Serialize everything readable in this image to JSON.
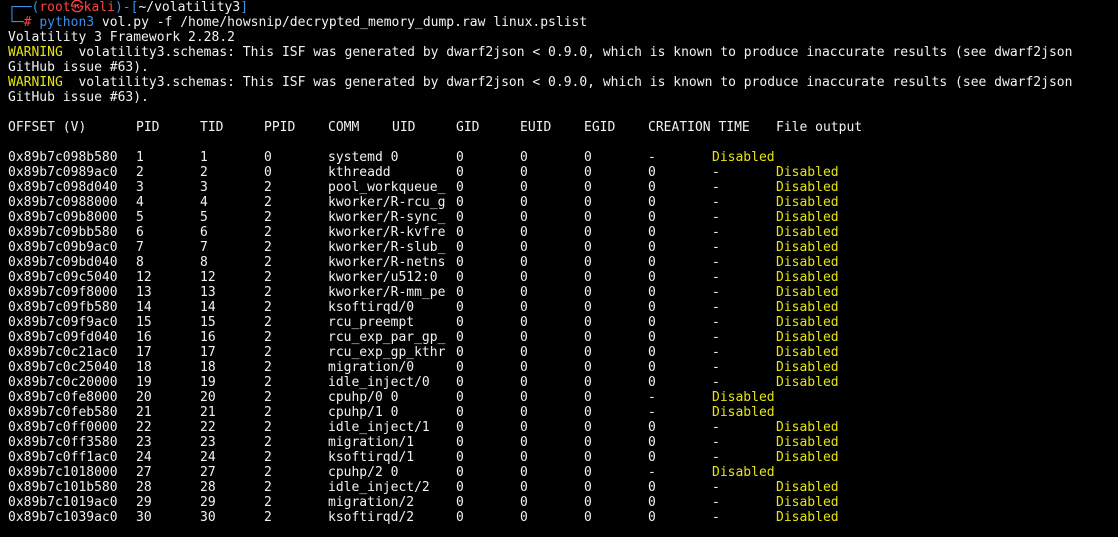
{
  "prompt": {
    "corner_top": "┌──(",
    "user": "root",
    "skull": "㉿",
    "host": "kali",
    "mid": ")-[",
    "path": "~/volatility3",
    "end": "]",
    "corner_bottom": "└─",
    "hash": "#",
    "command": "python3",
    "args": " vol.py -f /home/howsnip/decrypted_memory_dump.raw linux.pslist"
  },
  "output": {
    "framework": "Volatility 3 Framework 2.28.2",
    "warning_label": "WARNING",
    "warning_text": "  volatility3.schemas: This ISF was generated by dwarf2json < 0.9.0, which is known to produce inaccurate results (see dwarf2json",
    "warning_cont": "GitHub issue #63)."
  },
  "table": {
    "headers": {
      "offset": "OFFSET (V)",
      "pid": "PID",
      "tid": "TID",
      "ppid": "PPID",
      "comm": "COMM",
      "uid": "UID",
      "gid": "GID",
      "euid": "EUID",
      "egid": "EGID",
      "ctime": "CREATION TIME",
      "fout": "File output"
    },
    "rows": [
      {
        "offset": "0x89b7c098b580",
        "pid": "1",
        "tid": "1",
        "ppid": "0",
        "comm": "systemd 0",
        "gid": "0",
        "euid": "0",
        "egid": "0",
        "ctime": "-",
        "fout": "Disabled",
        "shift": true
      },
      {
        "offset": "0x89b7c0989ac0",
        "pid": "2",
        "tid": "2",
        "ppid": "0",
        "comm": "kthreadd",
        "gid": "0",
        "euid": "0",
        "egid": "0",
        "extra": "0",
        "ctime": "-",
        "fout": "Disabled"
      },
      {
        "offset": "0x89b7c098d040",
        "pid": "3",
        "tid": "3",
        "ppid": "2",
        "comm": "pool_workqueue_",
        "gid": "0",
        "euid": "0",
        "egid": "0",
        "extra": "0",
        "ctime": "-",
        "fout": "Disabled"
      },
      {
        "offset": "0x89b7c0988000",
        "pid": "4",
        "tid": "4",
        "ppid": "2",
        "comm": "kworker/R-rcu_g",
        "gid": "0",
        "euid": "0",
        "egid": "0",
        "extra": "0",
        "ctime": "-",
        "fout": "Disabled"
      },
      {
        "offset": "0x89b7c09b8000",
        "pid": "5",
        "tid": "5",
        "ppid": "2",
        "comm": "kworker/R-sync_",
        "gid": "0",
        "euid": "0",
        "egid": "0",
        "extra": "0",
        "ctime": "-",
        "fout": "Disabled"
      },
      {
        "offset": "0x89b7c09bb580",
        "pid": "6",
        "tid": "6",
        "ppid": "2",
        "comm": "kworker/R-kvfre",
        "gid": "0",
        "euid": "0",
        "egid": "0",
        "extra": "0",
        "ctime": "-",
        "fout": "Disabled"
      },
      {
        "offset": "0x89b7c09b9ac0",
        "pid": "7",
        "tid": "7",
        "ppid": "2",
        "comm": "kworker/R-slub_",
        "gid": "0",
        "euid": "0",
        "egid": "0",
        "extra": "0",
        "ctime": "-",
        "fout": "Disabled"
      },
      {
        "offset": "0x89b7c09bd040",
        "pid": "8",
        "tid": "8",
        "ppid": "2",
        "comm": "kworker/R-netns",
        "gid": "0",
        "euid": "0",
        "egid": "0",
        "extra": "0",
        "ctime": "-",
        "fout": "Disabled"
      },
      {
        "offset": "0x89b7c09c5040",
        "pid": "12",
        "tid": "12",
        "ppid": "2",
        "comm": "kworker/u512:0",
        "gid": "0",
        "euid": "0",
        "egid": "0",
        "extra": "0",
        "ctime": "-",
        "fout": "Disabled"
      },
      {
        "offset": "0x89b7c09f8000",
        "pid": "13",
        "tid": "13",
        "ppid": "2",
        "comm": "kworker/R-mm_pe",
        "gid": "0",
        "euid": "0",
        "egid": "0",
        "extra": "0",
        "ctime": "-",
        "fout": "Disabled"
      },
      {
        "offset": "0x89b7c09fb580",
        "pid": "14",
        "tid": "14",
        "ppid": "2",
        "comm": "ksoftirqd/0",
        "gid": "0",
        "euid": "0",
        "egid": "0",
        "extra": "0",
        "ctime": "-",
        "fout": "Disabled"
      },
      {
        "offset": "0x89b7c09f9ac0",
        "pid": "15",
        "tid": "15",
        "ppid": "2",
        "comm": "rcu_preempt",
        "gid": "0",
        "euid": "0",
        "egid": "0",
        "extra": "0",
        "ctime": "-",
        "fout": "Disabled"
      },
      {
        "offset": "0x89b7c09fd040",
        "pid": "16",
        "tid": "16",
        "ppid": "2",
        "comm": "rcu_exp_par_gp_",
        "gid": "0",
        "euid": "0",
        "egid": "0",
        "extra": "0",
        "ctime": "-",
        "fout": "Disabled"
      },
      {
        "offset": "0x89b7c0c21ac0",
        "pid": "17",
        "tid": "17",
        "ppid": "2",
        "comm": "rcu_exp_gp_kthr",
        "gid": "0",
        "euid": "0",
        "egid": "0",
        "extra": "0",
        "ctime": "-",
        "fout": "Disabled"
      },
      {
        "offset": "0x89b7c0c25040",
        "pid": "18",
        "tid": "18",
        "ppid": "2",
        "comm": "migration/0",
        "gid": "0",
        "euid": "0",
        "egid": "0",
        "extra": "0",
        "ctime": "-",
        "fout": "Disabled"
      },
      {
        "offset": "0x89b7c0c20000",
        "pid": "19",
        "tid": "19",
        "ppid": "2",
        "comm": "idle_inject/0",
        "gid": "0",
        "euid": "0",
        "egid": "0",
        "extra": "0",
        "ctime": "-",
        "fout": "Disabled"
      },
      {
        "offset": "0x89b7c0fe8000",
        "pid": "20",
        "tid": "20",
        "ppid": "2",
        "comm": "cpuhp/0 0",
        "gid": "0",
        "euid": "0",
        "egid": "0",
        "ctime": "-",
        "fout": "Disabled",
        "shift": true
      },
      {
        "offset": "0x89b7c0feb580",
        "pid": "21",
        "tid": "21",
        "ppid": "2",
        "comm": "cpuhp/1 0",
        "gid": "0",
        "euid": "0",
        "egid": "0",
        "ctime": "-",
        "fout": "Disabled",
        "shift": true
      },
      {
        "offset": "0x89b7c0ff0000",
        "pid": "22",
        "tid": "22",
        "ppid": "2",
        "comm": "idle_inject/1",
        "gid": "0",
        "euid": "0",
        "egid": "0",
        "extra": "0",
        "ctime": "-",
        "fout": "Disabled"
      },
      {
        "offset": "0x89b7c0ff3580",
        "pid": "23",
        "tid": "23",
        "ppid": "2",
        "comm": "migration/1",
        "gid": "0",
        "euid": "0",
        "egid": "0",
        "extra": "0",
        "ctime": "-",
        "fout": "Disabled"
      },
      {
        "offset": "0x89b7c0ff1ac0",
        "pid": "24",
        "tid": "24",
        "ppid": "2",
        "comm": "ksoftirqd/1",
        "gid": "0",
        "euid": "0",
        "egid": "0",
        "extra": "0",
        "ctime": "-",
        "fout": "Disabled"
      },
      {
        "offset": "0x89b7c1018000",
        "pid": "27",
        "tid": "27",
        "ppid": "2",
        "comm": "cpuhp/2 0",
        "gid": "0",
        "euid": "0",
        "egid": "0",
        "ctime": "-",
        "fout": "Disabled",
        "shift": true
      },
      {
        "offset": "0x89b7c101b580",
        "pid": "28",
        "tid": "28",
        "ppid": "2",
        "comm": "idle_inject/2",
        "gid": "0",
        "euid": "0",
        "egid": "0",
        "extra": "0",
        "ctime": "-",
        "fout": "Disabled"
      },
      {
        "offset": "0x89b7c1019ac0",
        "pid": "29",
        "tid": "29",
        "ppid": "2",
        "comm": "migration/2",
        "gid": "0",
        "euid": "0",
        "egid": "0",
        "extra": "0",
        "ctime": "-",
        "fout": "Disabled"
      },
      {
        "offset": "0x89b7c1039ac0",
        "pid": "30",
        "tid": "30",
        "ppid": "2",
        "comm": "ksoftirqd/2",
        "gid": "0",
        "euid": "0",
        "egid": "0",
        "extra": "0",
        "ctime": "-",
        "fout": "Disabled"
      }
    ]
  },
  "colors": {
    "background": "#000000",
    "prompt_frame": "#3b8eea",
    "prompt_user": "#ff4040",
    "warning": "#e5e510",
    "disabled": "#e5e510",
    "text": "#f2f2f2"
  }
}
